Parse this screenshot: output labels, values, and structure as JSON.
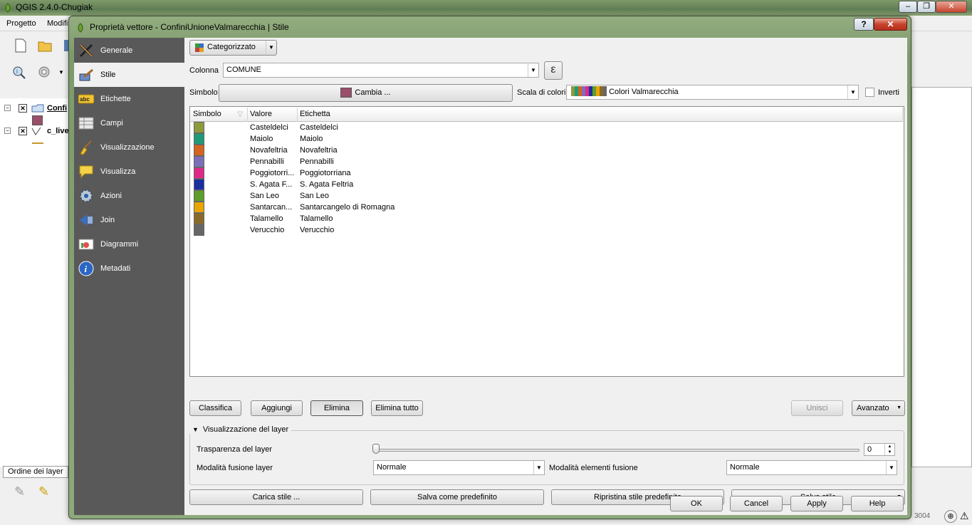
{
  "main": {
    "title": "QGIS 2.4.0-Chugiak",
    "menu": [
      "Progetto",
      "Modifi"
    ],
    "layers": [
      {
        "name": "Confi",
        "color": "#9b4f6b"
      },
      {
        "name": "c_live",
        "color": "#c89632"
      }
    ],
    "layer_tab": "Ordine dei layer",
    "status_text": "3004"
  },
  "dialog": {
    "title": "Proprietà vettore - ConfiniUnioneValmarecchia | Stile",
    "help_label": "?",
    "close_label": "✕",
    "sidebar": [
      {
        "label": "Generale",
        "icon": "tools-icon"
      },
      {
        "label": "Stile",
        "icon": "paint-brush-icon",
        "active": true
      },
      {
        "label": "Etichette",
        "icon": "abc-label-icon"
      },
      {
        "label": "Campi",
        "icon": "table-icon"
      },
      {
        "label": "Visualizzazione",
        "icon": "broom-icon"
      },
      {
        "label": "Visualizza",
        "icon": "speech-bubble-icon"
      },
      {
        "label": "Azioni",
        "icon": "gear-icon"
      },
      {
        "label": "Join",
        "icon": "join-icon"
      },
      {
        "label": "Diagrammi",
        "icon": "chart-icon"
      },
      {
        "label": "Metadati",
        "icon": "info-icon"
      }
    ],
    "renderer": "Categorizzato",
    "colonna_label": "Colonna",
    "colonna_value": "COMUNE",
    "expr_label": "ε",
    "simbolo_label": "Simbolo",
    "cambia_label": "Cambia ...",
    "symbol_color": "#9b4f6b",
    "scala_label": "Scala di colori",
    "scala_value": "Colori Valmarecchia",
    "inverti_label": "Inverti",
    "inverti_checked": false,
    "table": {
      "headers": [
        "Simbolo",
        "Valore",
        "Etichetta"
      ],
      "rows": [
        {
          "color": "#8f9a3c",
          "valore": "Casteldelci",
          "etichetta": "Casteldelci"
        },
        {
          "color": "#1f9a78",
          "valore": "Maiolo",
          "etichetta": "Maiolo"
        },
        {
          "color": "#d4641e",
          "valore": "Novafeltria",
          "etichetta": "Novafeltria"
        },
        {
          "color": "#7c6fb8",
          "valore": "Pennabilli",
          "etichetta": "Pennabilli"
        },
        {
          "color": "#e0288a",
          "valore": "Poggiotorri...",
          "etichetta": "Poggiotorriana"
        },
        {
          "color": "#1b2ea0",
          "valore": "S. Agata F...",
          "etichetta": "S. Agata Feltria"
        },
        {
          "color": "#5e9e2a",
          "valore": "San Leo",
          "etichetta": "San Leo"
        },
        {
          "color": "#e8a400",
          "valore": "Santarcan...",
          "etichetta": "Santarcangelo di Romagna"
        },
        {
          "color": "#8a6a2a",
          "valore": "Talamello",
          "etichetta": "Talamello"
        },
        {
          "color": "#666666",
          "valore": "Verucchio",
          "etichetta": "Verucchio"
        }
      ]
    },
    "buttons": {
      "classifica": "Classifica",
      "aggiungi": "Aggiungi",
      "elimina": "Elimina",
      "elimina_tutto": "Elimina tutto",
      "unisci": "Unisci",
      "avanzato": "Avanzato"
    },
    "vis": {
      "title": "Visualizzazione del layer",
      "trasparenza_label": "Trasparenza del layer",
      "trasparenza_value": "0",
      "fusione_layer_label": "Modalità fusione layer",
      "fusione_layer_value": "Normale",
      "fusione_elementi_label": "Modalità elementi fusione",
      "fusione_elementi_value": "Normale"
    },
    "style_buttons": {
      "carica": "Carica stile ...",
      "salva_predefinito": "Salva come predefinito",
      "ripristina": "Ripristina stile predefinito",
      "salva": "Salva stile"
    },
    "footer": {
      "ok": "OK",
      "cancel": "Cancel",
      "apply": "Apply",
      "help": "Help"
    }
  }
}
